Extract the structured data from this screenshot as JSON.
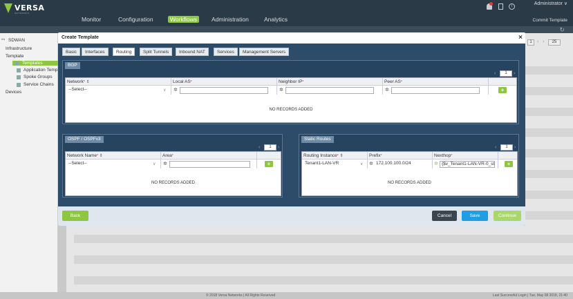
{
  "header": {
    "logo_text": "VERSA",
    "logo_sub": "NETWORKS",
    "nav": [
      "Monitor",
      "Configuration",
      "Workflows",
      "Administration",
      "Analytics"
    ],
    "active_nav": "Workflows",
    "user": "Administrator ∨",
    "commit": "Commit Template"
  },
  "sidebar": {
    "items": [
      "SDWAN",
      "Infrastructure",
      "Template",
      "Templates",
      "Application Temp",
      "Spoke Groups",
      "Service Chains",
      "Devices"
    ]
  },
  "page_pager": {
    "left": "‹",
    "page": "1",
    "right": "›",
    "size": "25"
  },
  "modal": {
    "title": "Create Template",
    "close": "×",
    "tabs": [
      "Basic",
      "Interfaces",
      "Routing",
      "Split Tunnels",
      "Inbound NAT",
      "Services",
      "Management Servers"
    ],
    "active_tab": "Routing",
    "bgp": {
      "label": "BGP",
      "columns": [
        "Network",
        "Local AS",
        "Neighbor IP",
        "Peer AS"
      ],
      "row": {
        "network": "--Select--",
        "local_as": "",
        "neighbor_ip": "",
        "peer_as": ""
      },
      "empty": "NO RECORDS ADDED",
      "page": "1"
    },
    "ospf": {
      "label": "OSPF / OSPFv3",
      "columns": [
        "Network Name",
        "Area"
      ],
      "row": {
        "network_name": "--Select--",
        "area": ""
      },
      "empty": "NO RECORDS ADDED",
      "page": "1"
    },
    "static": {
      "label": "Static Routes",
      "columns": [
        "Routing Instance",
        "Prefix",
        "Nexthop"
      ],
      "row": {
        "routing_instance": "Tenant1-LAN-VR",
        "prefix": "172.100.100.0/24",
        "nexthop": "{$v_Tenant1-LAN-VR-0_st"
      },
      "empty": "NO RECORDS ADDED",
      "page": "1"
    },
    "buttons": {
      "back": "Back",
      "cancel": "Cancel",
      "save": "Save",
      "continue": "Continue"
    }
  },
  "footer": {
    "copyright": "© 2018 Versa Networks | All Rights Reserved",
    "login": "Last Successful Login | Tue, May 08 2018, 21:40"
  },
  "colors": {
    "accent": "#8dc63f",
    "header": "#2b3a47",
    "modal": "#2d4c69",
    "save": "#1f9ee6"
  }
}
